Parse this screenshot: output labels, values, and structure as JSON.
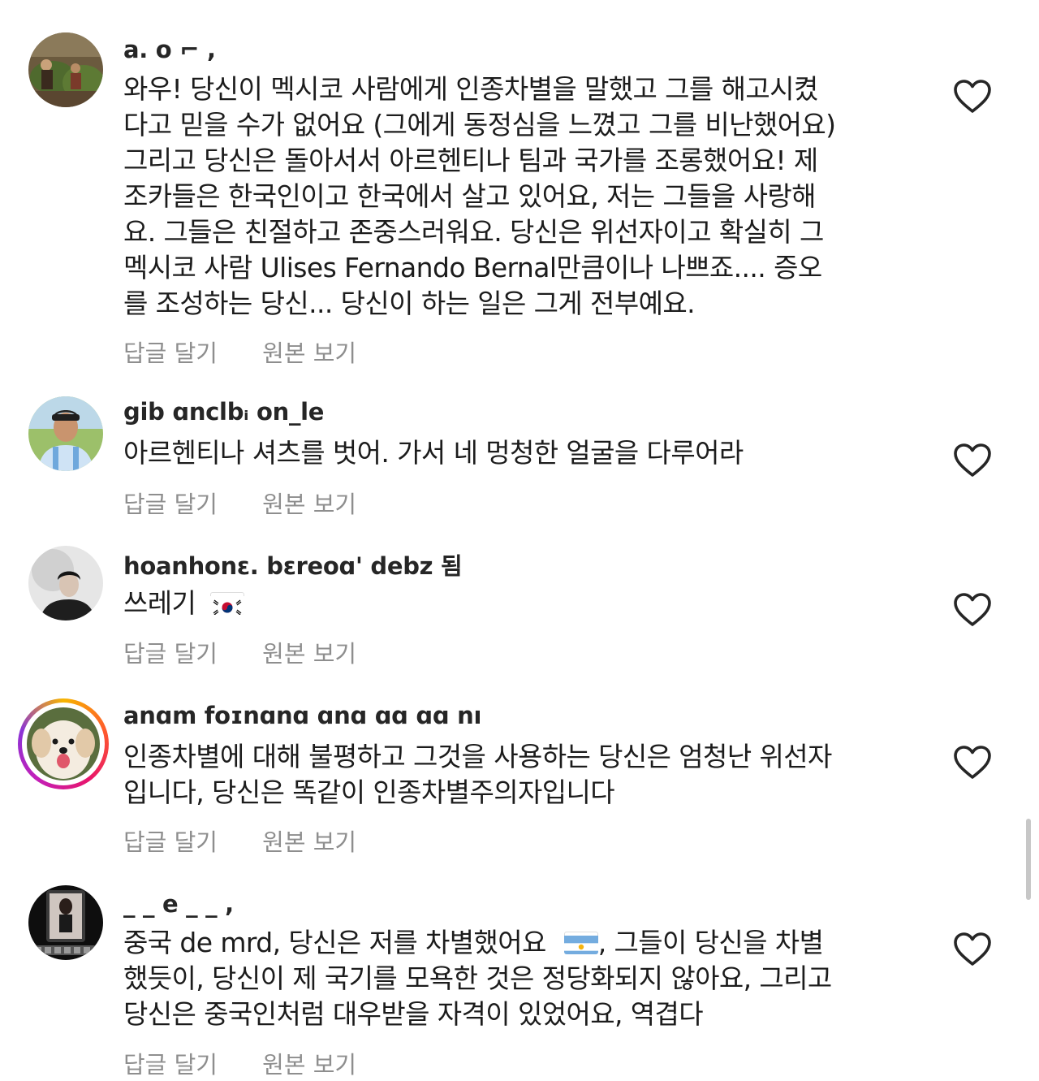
{
  "colors": {
    "text": "#1c1c1c",
    "username": "#262626",
    "muted": "#8e8e8e",
    "story_ring": [
      "#f7b500",
      "#e8156b",
      "#8b34d6"
    ]
  },
  "icons": {
    "like": "heart-outline-icon"
  },
  "comments": [
    {
      "username": "a.     o  ⌐         ,",
      "lines": [
        "와우! 당신이 멕시코 사람에게 인종차별을 말했고 그를 해고시켰",
        "다고 믿을 수가 없어요 (그에게 동정심을 느꼈고 그를 비난했어요)",
        "그리고 당신은 돌아서서 아르헨티나 팀과 국가를 조롱했어요! 제",
        "조카들은 한국인이고 한국에서 살고 있어요, 저는 그들을 사랑해",
        "요. 그들은 친절하고 존중스러워요. 당신은 위선자이고 확실히 그",
        "멕시코 사람 Ulises Fernando Bernal만큼이나 나쁘죠.... 증오",
        "를 조성하는 당신... 당신이 하는 일은 그게 전부예요."
      ],
      "reply_label": "답글 달기",
      "see_original_label": "원본 보기"
    },
    {
      "username": "gib  ɑnclbᵢ  on_le",
      "lines": [
        "아르헨티나 셔츠를 벗어. 가서 네 멍청한 얼굴을 다루어라"
      ],
      "reply_label": "답글 달기",
      "see_original_label": "원본 보기"
    },
    {
      "username": "hoanhonɛ. bɛreoɑ' debz 됨",
      "lines": [
        "쓰레기"
      ],
      "flag": "south-korea-flag",
      "reply_label": "답글 달기",
      "see_original_label": "원본 보기"
    },
    {
      "username": "anɑm foɪnɑnɑ ɑnɑ ɑɑ ɑɑ   nı",
      "lines": [
        "인종차별에 대해 불평하고 그것을 사용하는 당신은 엄청난 위선자",
        "입니다, 당신은 똑같이 인종차별주의자입니다"
      ],
      "reply_label": "답글 달기",
      "see_original_label": "원본 보기"
    },
    {
      "username": "_ _ e   _ _ ,",
      "lines": [
        "중국 de mrd, 당신은 저를 차별했어요",
        "했듯이, 당신이 제 국기를 모욕한 것은 정당화되지 않아요, 그리고",
        "당신은 중국인처럼 대우받을 자격이 있었어요, 역겹다"
      ],
      "line1_tail": ", 그들이 당신을 차별",
      "flag": "argentina-flag",
      "reply_label": "답글 달기",
      "see_original_label": "원본 보기"
    }
  ]
}
